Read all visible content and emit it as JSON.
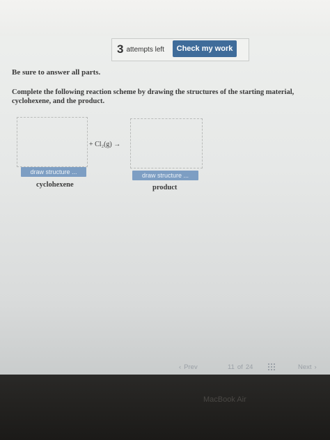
{
  "header": {
    "attempts_count": "3",
    "attempts_text": "attempts left",
    "check_label": "Check my work"
  },
  "question": {
    "notice": "Be sure to answer all parts.",
    "instruction": "Complete the following reaction scheme by drawing the structures of the starting material, cyclohexene, and the product.",
    "reagent": "+ Cl₂(g) →",
    "start": {
      "button": "draw structure ...",
      "label": "cyclohexene"
    },
    "product": {
      "button": "draw structure ...",
      "label": "product"
    }
  },
  "footer": {
    "prev_label": "Prev",
    "page_current": "11",
    "page_sep": "of",
    "page_total": "24",
    "next_label": "Next"
  },
  "device": {
    "brand": "MacBook Air"
  },
  "colors": {
    "accent": "#3f6c9a",
    "draw_button": "#7d9ec3"
  },
  "icons": {
    "prev": "chevron-left-icon",
    "next": "chevron-right-icon",
    "grid": "grid-icon"
  }
}
